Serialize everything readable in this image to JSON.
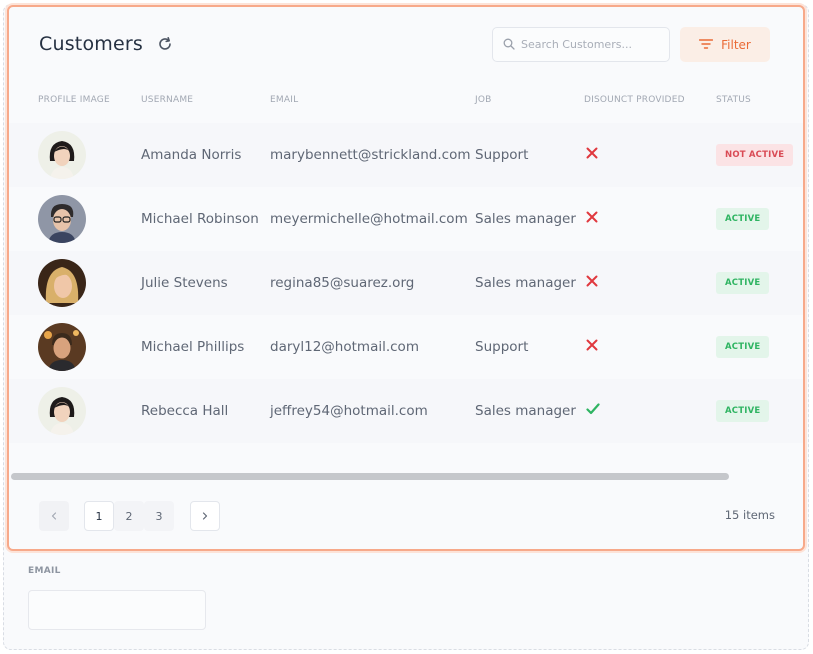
{
  "header": {
    "title": "Customers",
    "search_placeholder": "Search Customers...",
    "filter_label": "Filter"
  },
  "table": {
    "columns": [
      "PROFILE IMAGE",
      "USERNAME",
      "EMAIL",
      "JOB",
      "DISOUNCT PROVIDED",
      "STATUS"
    ],
    "rows": [
      {
        "username": "Amanda Norris",
        "email": "marybennett@strickland.com",
        "job": "Support",
        "discount": "no",
        "status": "NOT ACTIVE"
      },
      {
        "username": "Michael Robinson",
        "email": "meyermichelle@hotmail.com",
        "job": "Sales manager",
        "discount": "no",
        "status": "ACTIVE"
      },
      {
        "username": "Julie Stevens",
        "email": "regina85@suarez.org",
        "job": "Sales manager",
        "discount": "no",
        "status": "ACTIVE"
      },
      {
        "username": "Michael Phillips",
        "email": "daryl12@hotmail.com",
        "job": "Support",
        "discount": "no",
        "status": "ACTIVE"
      },
      {
        "username": "Rebecca Hall",
        "email": "jeffrey54@hotmail.com",
        "job": "Sales manager",
        "discount": "yes",
        "status": "ACTIVE"
      }
    ]
  },
  "pagination": {
    "prev_icon": "chevron-left-icon",
    "next_icon": "chevron-right-icon",
    "pages": [
      "1",
      "2",
      "3"
    ],
    "current": "1",
    "count_text": "15 items"
  },
  "form": {
    "email_label": "EMAIL",
    "email_value": ""
  },
  "colors": {
    "accent": "#ea6a36",
    "card_border": "#f7a98a",
    "active_bg": "#e3f5ea",
    "active_fg": "#2fb462",
    "inactive_bg": "#fbe3e5",
    "inactive_fg": "#d94b55",
    "cross": "#e0383e",
    "check": "#2fb462"
  }
}
